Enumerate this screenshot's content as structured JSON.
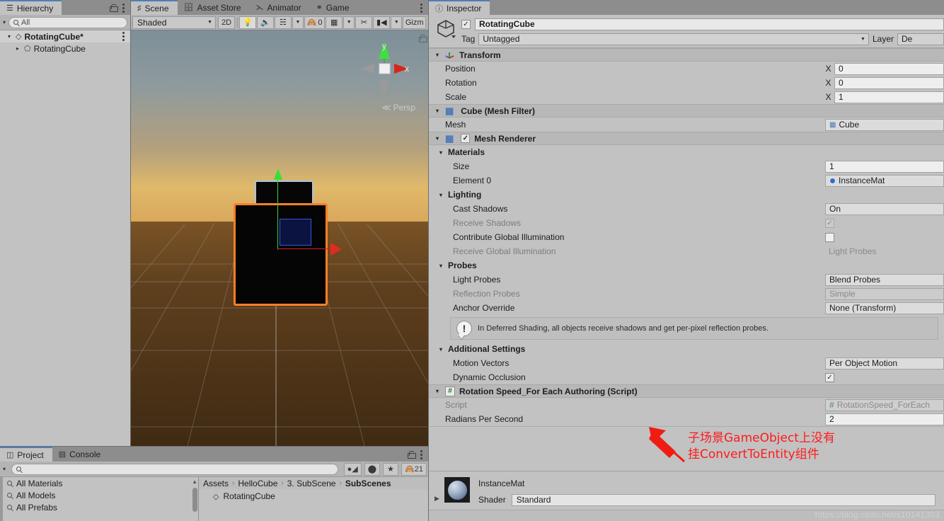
{
  "hierarchy": {
    "tab_label": "Hierarchy",
    "tab_icon": "hierarchy-icon",
    "search_placeholder": "All",
    "items": [
      {
        "label": "RotatingCube*",
        "icon": "scene-icon",
        "selected": true,
        "expanded": true
      },
      {
        "label": "RotatingCube",
        "icon": "cube-icon",
        "selected": false,
        "expanded": false
      }
    ]
  },
  "scene": {
    "tabs": [
      {
        "label": "Scene",
        "icon": "grid-icon",
        "active": true
      },
      {
        "label": "Asset Store",
        "icon": "store-icon",
        "active": false
      },
      {
        "label": "Animator",
        "icon": "animator-icon",
        "active": false
      },
      {
        "label": "Game",
        "icon": "game-icon",
        "active": false
      }
    ],
    "toolbar": {
      "draw_mode": "Shaded",
      "two_d": "2D",
      "lighting_icon": "lightbulb-icon",
      "audio_icon": "speaker-icon",
      "fx_icon": "effects-icon",
      "hidden_count": "0",
      "hidden_icon": "eye-off-icon",
      "grid_icon": "grid-snap-icon",
      "tools_icon": "tools-icon",
      "camera_icon": "camera-icon",
      "gizmos_label": "Gizm"
    },
    "gizmo": {
      "axis_y": "y",
      "axis_x": "x",
      "projection": "Persp",
      "persp_prefix": "≪"
    }
  },
  "project": {
    "tabs": [
      {
        "label": "Project",
        "icon": "project-icon",
        "active": true
      },
      {
        "label": "Console",
        "icon": "console-icon",
        "active": false
      }
    ],
    "search_placeholder": "",
    "filter_icons": [
      "asset-type-icon",
      "label-icon",
      "favorite-star-icon"
    ],
    "hidden_label": "21",
    "hidden_icon": "eye-off-icon",
    "favorites": [
      {
        "label": "All Materials",
        "icon": "search-icon"
      },
      {
        "label": "All Models",
        "icon": "search-icon"
      },
      {
        "label": "All Prefabs",
        "icon": "search-icon"
      }
    ],
    "breadcrumbs": [
      "Assets",
      "HelloCube",
      "3. SubScene",
      "SubScenes"
    ],
    "breadcrumb_sep": "›",
    "assets": [
      {
        "label": "RotatingCube",
        "icon": "scene-asset-icon"
      }
    ]
  },
  "inspector": {
    "tab_label": "Inspector",
    "tab_icon": "info-icon",
    "object": {
      "icon": "gameobject-cube-icon",
      "enabled": true,
      "name": "RotatingCube",
      "tag_label": "Tag",
      "tag_value": "Untagged",
      "layer_label": "Layer",
      "layer_value": "De"
    },
    "transform": {
      "title": "Transform",
      "icon": "transform-axes-icon",
      "rows": [
        {
          "label": "Position",
          "axis": "X",
          "value": "0"
        },
        {
          "label": "Rotation",
          "axis": "X",
          "value": "0"
        },
        {
          "label": "Scale",
          "axis": "X",
          "value": "1"
        }
      ]
    },
    "mesh_filter": {
      "title": "Cube (Mesh Filter)",
      "icon": "mesh-filter-icon",
      "mesh_label": "Mesh",
      "mesh_value": "Cube"
    },
    "mesh_renderer": {
      "title": "Mesh Renderer",
      "icon": "mesh-renderer-icon",
      "enabled": true,
      "materials_group": "Materials",
      "size_label": "Size",
      "size_value": "1",
      "element0_label": "Element 0",
      "element0_value": "InstanceMat",
      "lighting_group": "Lighting",
      "cast_shadows_label": "Cast Shadows",
      "cast_shadows_value": "On",
      "receive_shadows_label": "Receive Shadows",
      "receive_shadows_checked": true,
      "contribute_gi_label": "Contribute Global Illumination",
      "contribute_gi_checked": false,
      "receive_gi_label": "Receive Global Illumination",
      "receive_gi_value": "Light Probes",
      "probes_group": "Probes",
      "light_probes_label": "Light Probes",
      "light_probes_value": "Blend Probes",
      "reflection_probes_label": "Reflection Probes",
      "reflection_probes_value": "Simple",
      "anchor_override_label": "Anchor Override",
      "anchor_override_value": "None (Transform)",
      "info_text": "In Deferred Shading, all objects receive shadows and get per-pixel reflection probes.",
      "info_icon": "warning-bubble-icon",
      "additional_group": "Additional Settings",
      "motion_vectors_label": "Motion Vectors",
      "motion_vectors_value": "Per Object Motion",
      "dynamic_occlusion_label": "Dynamic Occlusion",
      "dynamic_occlusion_checked": true
    },
    "script_component": {
      "title": "Rotation Speed_For Each Authoring (Script)",
      "icon": "script-hash-icon",
      "script_label": "Script",
      "script_value": "RotationSpeed_ForEach",
      "script_value_icon": "script-hash-icon",
      "radians_label": "Radians Per Second",
      "radians_value": "2"
    },
    "material_preview": {
      "name": "InstanceMat",
      "preview_icon": "material-sphere-icon",
      "shader_label": "Shader",
      "shader_value": "Standard"
    }
  },
  "annotation": {
    "line1": "子场景GameObject上没有",
    "line2": "挂ConvertToEntity组件",
    "color": "#ff1a1a",
    "arrow": "red-arrow-pointer"
  },
  "watermark": {
    "text": "https://blog.csdn.net/s10141303"
  },
  "colors": {
    "selection_outline": "#ff7f27",
    "child_outline": "#a9c3d8",
    "axis_y": "#35e035",
    "axis_x": "#e22b1d",
    "tab_accent": "#4e7fb5",
    "panel_bg": "#c2c2c2"
  }
}
